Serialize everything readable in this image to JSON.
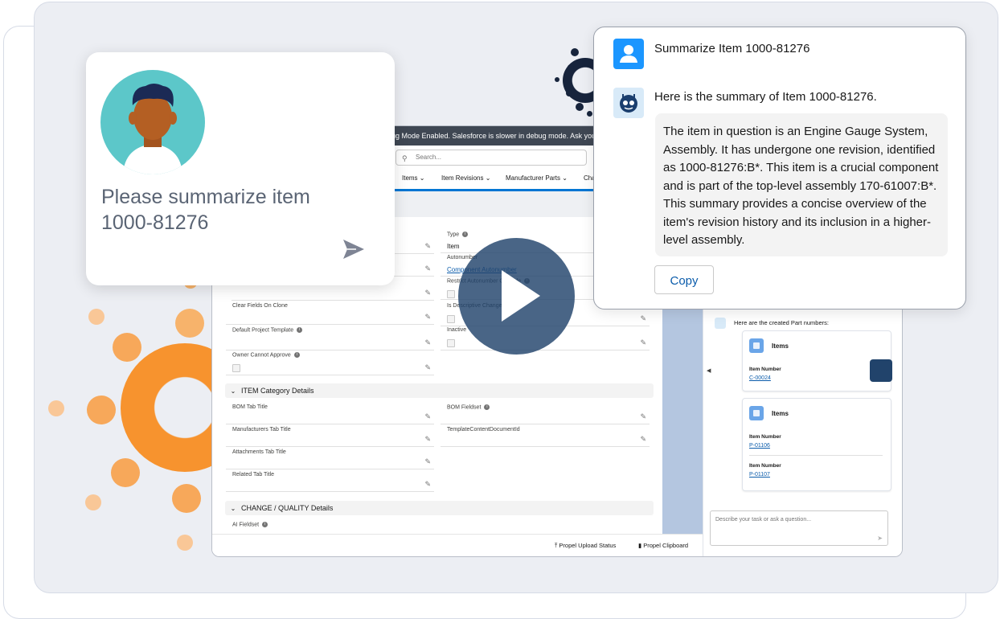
{
  "app": {
    "debug_banner": "bug Mode Enabled. Salesforce is slower in debug mode. Ask your adm",
    "search_placeholder": "Search...",
    "nav_tabs": [
      "Items",
      "Item Revisions",
      "Manufacturer Parts",
      "Cha"
    ],
    "fields_left": [
      {
        "label": "Clear Fields On Clone"
      },
      {
        "label": "Default Project Template"
      },
      {
        "label": "Owner Cannot Approve"
      }
    ],
    "fields_right": [
      {
        "label": "Type",
        "value": "Item"
      },
      {
        "label": "Autonumber",
        "value": "Component Autonumber"
      },
      {
        "label": "Restrict Autonumber Override"
      },
      {
        "label": "Is Descriptive Change"
      },
      {
        "label": "Inactive"
      }
    ],
    "section_item_category": "ITEM Category Details",
    "category_left": [
      "BOM Tab Title",
      "Manufacturers Tab Title",
      "Attachments Tab Title",
      "Related Tab Title"
    ],
    "category_right": [
      "BOM Fieldset",
      "TemplateContentDocumentId"
    ],
    "section_change_quality": "CHANGE / QUALITY Details",
    "ai_fieldset_label": "AI Fieldset",
    "bottom_bar": {
      "upload_status": "Propel Upload Status",
      "clipboard": "Propel Clipboard"
    },
    "chat_panel": {
      "created_message": "Here are the created Part numbers:",
      "card1": {
        "title": "Items",
        "label": "Item Number",
        "value": "C-00024"
      },
      "card2": {
        "title": "Items",
        "label1": "Item Number",
        "value1": "P-01106",
        "label2": "Item Number",
        "value2": "P-01107"
      },
      "input_placeholder": "Describe your task or ask a question..."
    }
  },
  "prompt_card": {
    "text": "Please summarize item 1000-81276"
  },
  "ai_card": {
    "question": "Summarize Item 1000-81276",
    "answer_intro": "Here is the summary of Item 1000-81276.",
    "summary": "The item in question is an Engine Gauge System, Assembly. It has undergone one revision, identified as 1000-81276:B*. This item is a crucial component and is part of the top-level assembly 170-61007:B*. This summary provides a concise overview of the item's revision history and its inclusion in a higher-level assembly.",
    "copy_label": "Copy"
  },
  "colors": {
    "accent_orange": "#f7932e",
    "navy": "#17243c",
    "brand_blue": "#1b96ff",
    "link_blue": "#0b5cab"
  }
}
